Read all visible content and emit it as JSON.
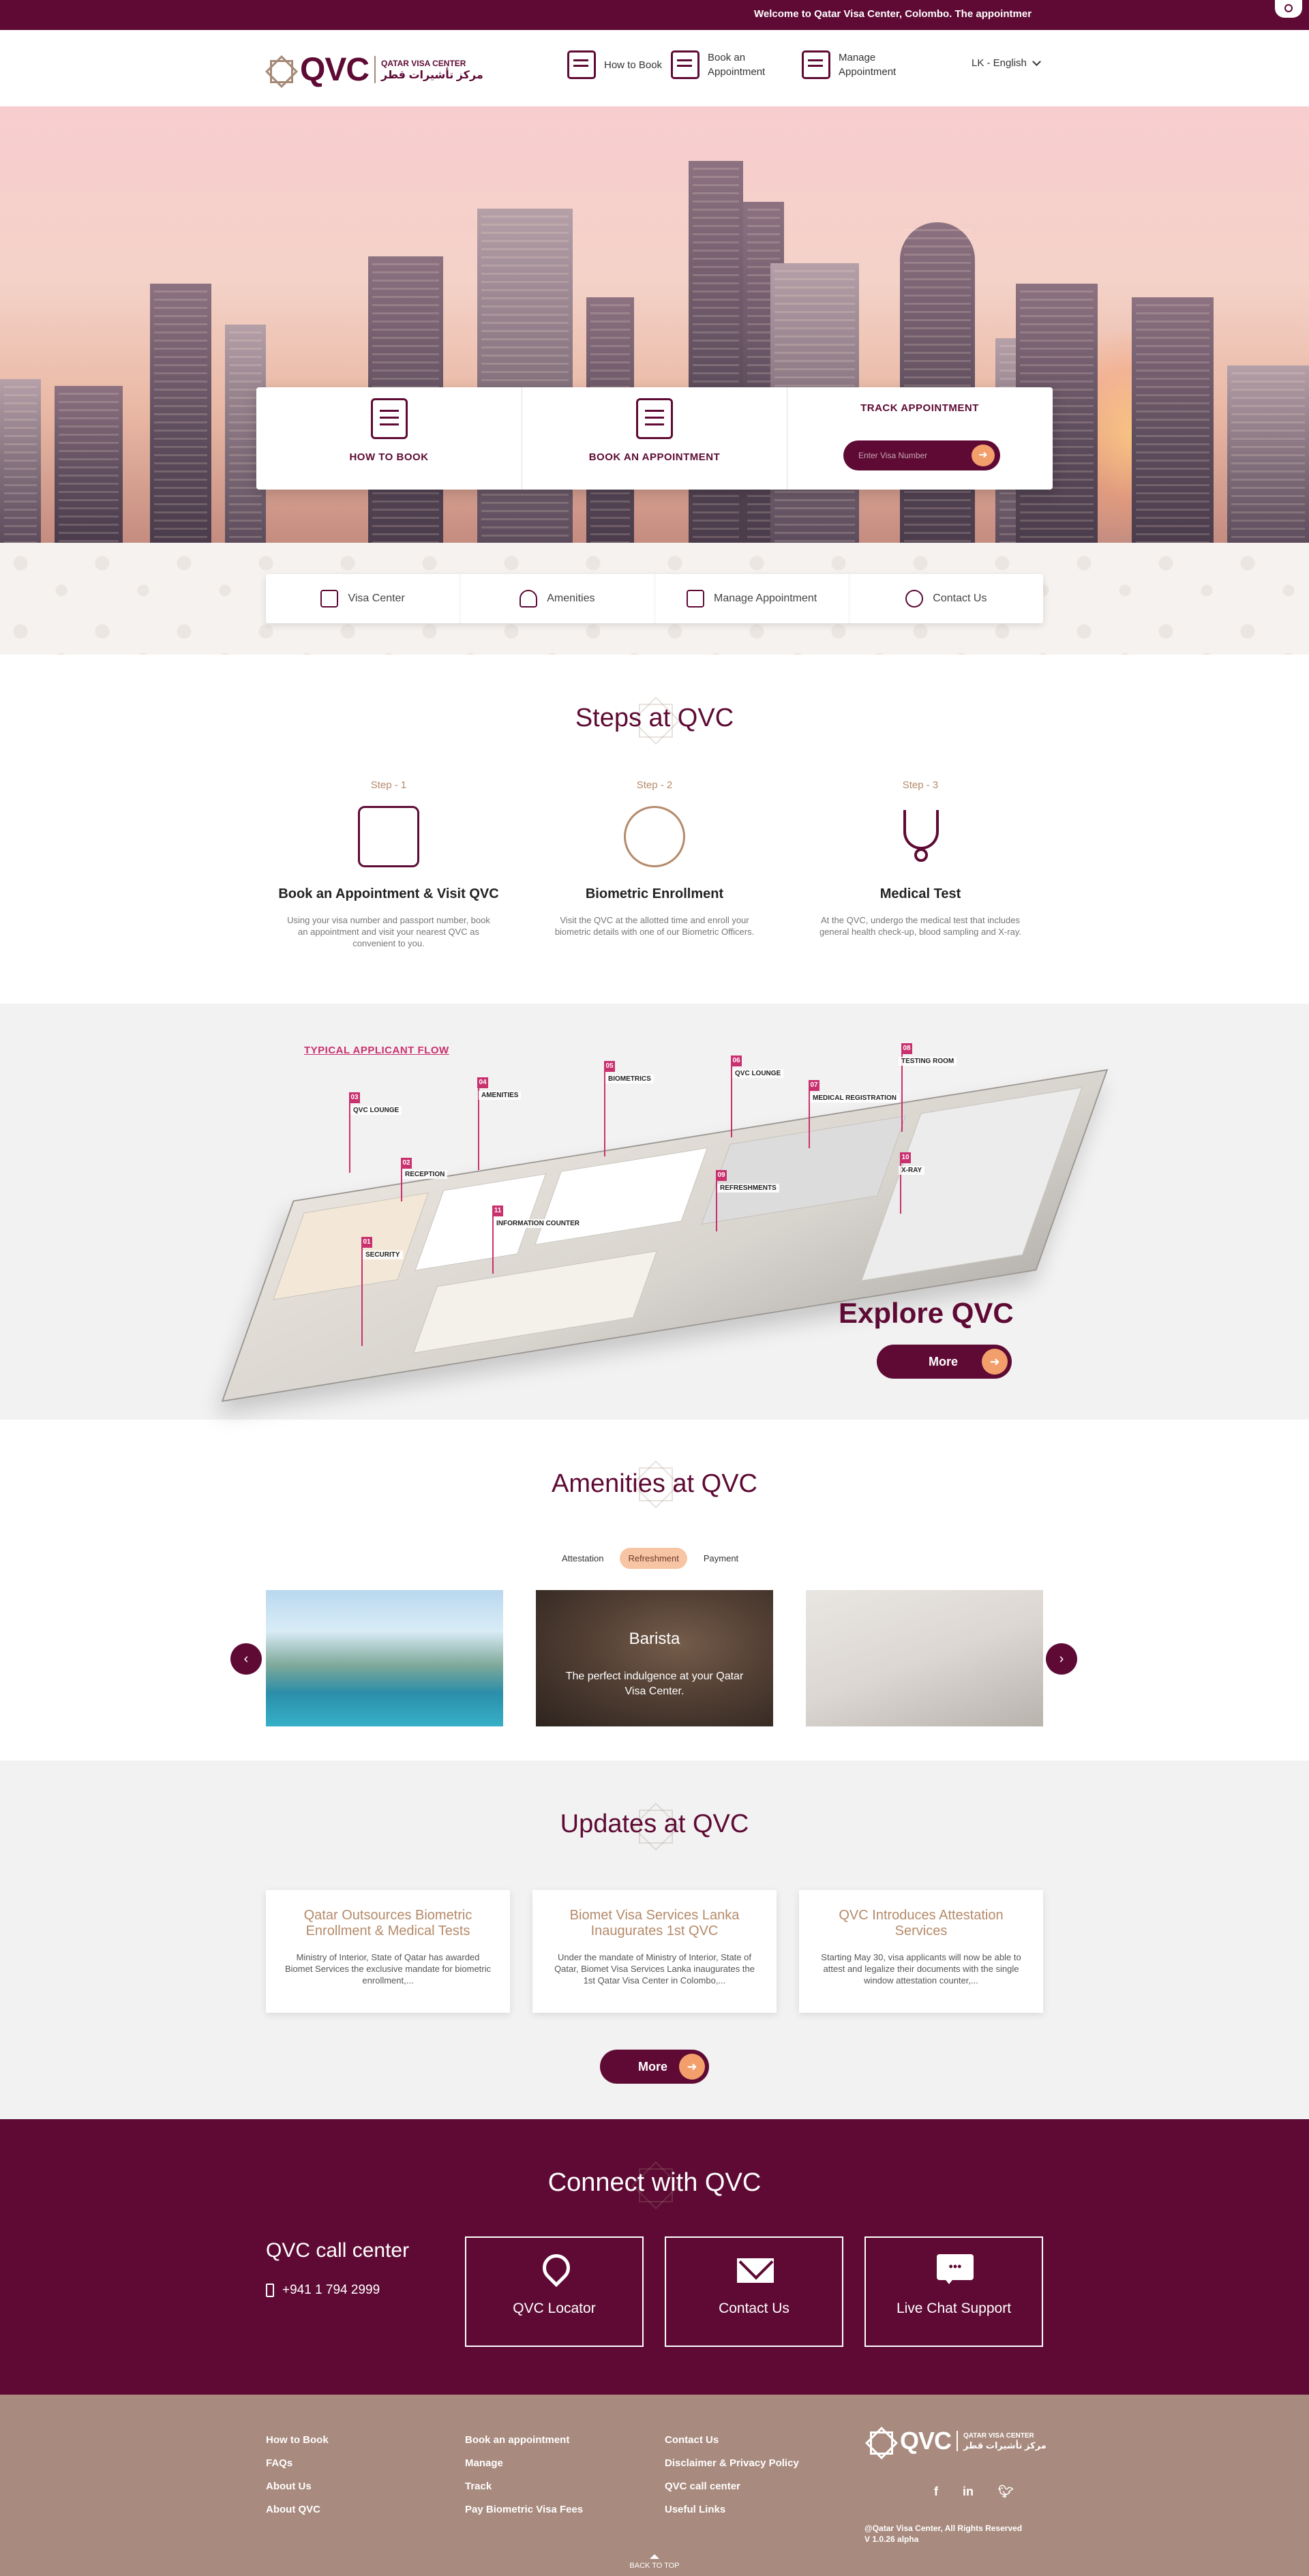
{
  "top_bar": {
    "announcement": "Welcome to Qatar Visa Center, Colombo. The appointmer"
  },
  "header": {
    "logo": {
      "mark": "QVC",
      "name_en": "QATAR VISA CENTER",
      "name_ar": "مركز تأشيرات قطر"
    },
    "nav": [
      {
        "label": "How to Book",
        "icon": "edit-document-icon"
      },
      {
        "label": "Book an Appointment",
        "icon": "calendar-clock-icon"
      },
      {
        "label": "Manage Appointment",
        "icon": "calendar-check-icon"
      }
    ],
    "language": "LK - English"
  },
  "hero": {
    "how_to_book": "HOW TO BOOK",
    "book_appointment": "BOOK AN APPOINTMENT",
    "track_title": "TRACK APPOINTMENT",
    "track_placeholder": "Enter Visa Number"
  },
  "quick_links": [
    "Visa Center",
    "Amenities",
    "Manage Appointment",
    "Contact Us"
  ],
  "steps": {
    "title": "Steps at QVC",
    "items": [
      {
        "num": "Step - 1",
        "title": "Book an Appointment & Visit QVC",
        "desc": "Using your visa number and passport number, book an appointment and visit your nearest QVC as convenient to you."
      },
      {
        "num": "Step - 2",
        "title": "Biometric Enrollment",
        "desc": "Visit the QVC at the allotted time and enroll your biometric details with one of our Biometric Officers."
      },
      {
        "num": "Step - 3",
        "title": "Medical Test",
        "desc": "At the QVC, undergo the medical test that includes general health check-up, blood sampling and X-ray."
      }
    ]
  },
  "explore": {
    "flow_title": "TYPICAL APPLICANT FLOW",
    "pins": [
      {
        "num": "03",
        "label": "QVC LOUNGE"
      },
      {
        "num": "04",
        "label": "AMENITIES"
      },
      {
        "num": "05",
        "label": "BIOMETRICS"
      },
      {
        "num": "06",
        "label": "QVC LOUNGE"
      },
      {
        "num": "07",
        "label": "MEDICAL REGISTRATION"
      },
      {
        "num": "08",
        "label": "TESTING ROOM"
      },
      {
        "num": "02",
        "label": "RECEPTION"
      },
      {
        "num": "01",
        "label": "SECURITY"
      },
      {
        "num": "11",
        "label": "INFORMATION COUNTER"
      },
      {
        "num": "09",
        "label": "REFRESHMENTS"
      },
      {
        "num": "10",
        "label": "X-RAY"
      }
    ],
    "title": "Explore QVC",
    "button": "More"
  },
  "amenities": {
    "title": "Amenities at QVC",
    "tabs": [
      "Attestation",
      "Refreshment",
      "Payment"
    ],
    "active_tab": "Refreshment",
    "featured": {
      "title": "Barista",
      "text": "The perfect indulgence at your Qatar Visa Center."
    }
  },
  "updates": {
    "title": "Updates at QVC",
    "items": [
      {
        "title": "Qatar Outsources Biometric Enrollment & Medical Tests",
        "text": "Ministry of Interior, State of Qatar has awarded Biomet Services the exclusive mandate for biometric enrollment,..."
      },
      {
        "title": "Biomet Visa Services Lanka Inaugurates 1st QVC",
        "text": "Under the mandate of Ministry of Interior, State of Qatar, Biomet Visa Services Lanka inaugurates the 1st Qatar Visa Center in Colombo,..."
      },
      {
        "title": "QVC Introduces Attestation Services",
        "text": "Starting May 30, visa applicants will now be able to attest and legalize their documents with the single window attestation counter,..."
      }
    ],
    "button": "More"
  },
  "connect": {
    "title": "Connect with QVC",
    "call_center_title": "QVC call center",
    "phone": "+941 1 794 2999",
    "boxes": [
      {
        "label": "QVC Locator",
        "icon": "location-pin-icon"
      },
      {
        "label": "Contact Us",
        "icon": "envelope-icon"
      },
      {
        "label": "Live Chat Support",
        "icon": "chat-bubble-icon"
      }
    ]
  },
  "footer": {
    "col1": [
      "How to Book",
      "FAQs",
      "About Us",
      "About QVC"
    ],
    "col2": [
      "Book an appointment",
      "Manage",
      "Track",
      "Pay Biometric Visa Fees"
    ],
    "col3": [
      "Contact Us",
      "Disclaimer & Privacy Policy",
      "QVC call center",
      "Useful Links"
    ],
    "social": [
      "f",
      "in",
      "twitter"
    ],
    "copyright": "@Qatar Visa Center, All Rights Reserved",
    "version": "V 1.0.26 alpha",
    "back_to_top": "BACK TO TOP"
  },
  "colors": {
    "brand": "#5e0a34",
    "accent": "#f29f6c",
    "footer": "#a88a7e",
    "gold": "#b58a6a"
  }
}
